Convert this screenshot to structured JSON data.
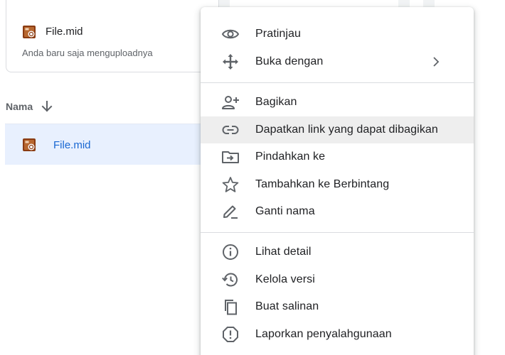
{
  "file_card": {
    "name": "File.mid",
    "subtitle": "Anda baru saja menguploadnya"
  },
  "list": {
    "header_label": "Nama",
    "sort_icon": "arrow-down-icon",
    "row_name": "File.mid"
  },
  "menu": {
    "items": [
      {
        "label": "Pratinjau",
        "icon": "eye-icon"
      },
      {
        "label": "Buka dengan",
        "icon": "move-arrows-icon",
        "submenu": true
      },
      {
        "label": "Bagikan",
        "icon": "person-add-icon"
      },
      {
        "label": "Dapatkan link yang dapat dibagikan",
        "icon": "link-icon",
        "highlighted": true
      },
      {
        "label": "Pindahkan ke",
        "icon": "folder-move-icon"
      },
      {
        "label": "Tambahkan ke Berbintang",
        "icon": "star-icon"
      },
      {
        "label": "Ganti nama",
        "icon": "pencil-icon"
      },
      {
        "label": "Lihat detail",
        "icon": "info-icon"
      },
      {
        "label": "Kelola versi",
        "icon": "history-icon"
      },
      {
        "label": "Buat salinan",
        "icon": "copy-icon"
      },
      {
        "label": "Laporkan penyalahgunaan",
        "icon": "report-icon"
      }
    ]
  },
  "colors": {
    "selected_row": "#e8f0fe",
    "link_text": "#1967d2",
    "menu_highlight": "#eeeeee",
    "icon_gray": "#5f6368"
  }
}
